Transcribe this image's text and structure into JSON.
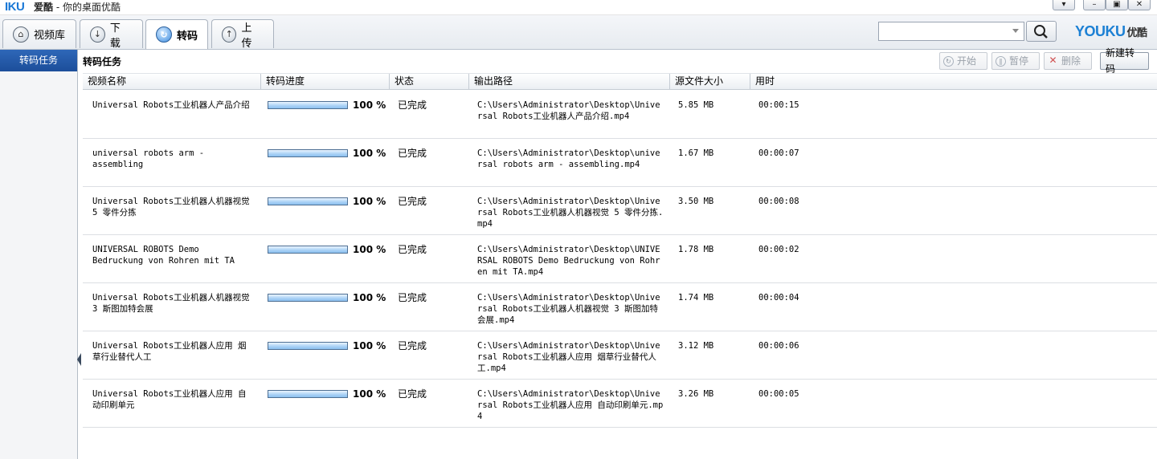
{
  "app": {
    "logo": "IKU",
    "title_bold": "爱酷",
    "title_rest": " - 你的桌面优酷"
  },
  "window_controls": {
    "menu": "▾",
    "minimize": "–",
    "restore": "▣",
    "close": "✕"
  },
  "tabs": [
    {
      "label": "视频库",
      "icon": "house-icon"
    },
    {
      "label": "下 载",
      "icon": "download-icon"
    },
    {
      "label": "转码",
      "icon": "transcode-icon",
      "active": true
    },
    {
      "label": "上 传",
      "icon": "upload-icon"
    }
  ],
  "search": {
    "value": "",
    "placeholder": ""
  },
  "brand": {
    "name": "YOUKU",
    "cn": "优酷"
  },
  "sidebar": {
    "items": [
      {
        "label": "转码任务",
        "active": true
      }
    ]
  },
  "main": {
    "title": "转码任务",
    "toolbar": {
      "start": "开始",
      "pause": "暂停",
      "delete": "删除",
      "new": "新建转码"
    },
    "columns": [
      "视频名称",
      "转码进度",
      "状态",
      "输出路径",
      "源文件大小",
      "用时"
    ],
    "rows": [
      {
        "name": "Universal  Robots工业机器人产品介绍",
        "progress": 100,
        "progress_label": "100 %",
        "status": "已完成",
        "path": "C:\\Users\\Administrator\\Desktop\\Universal  Robots工业机器人产品介绍.mp4",
        "size": "5.85 MB",
        "time": "00:00:15"
      },
      {
        "name": "universal robots arm - assembling",
        "progress": 100,
        "progress_label": "100 %",
        "status": "已完成",
        "path": "C:\\Users\\Administrator\\Desktop\\universal robots arm - assembling.mp4",
        "size": "1.67 MB",
        "time": "00:00:07"
      },
      {
        "name": "Universal  Robots工业机器人机器视觉 5 零件分拣",
        "progress": 100,
        "progress_label": "100 %",
        "status": "已完成",
        "path": "C:\\Users\\Administrator\\Desktop\\Universal  Robots工业机器人机器视觉 5 零件分拣.mp4",
        "size": "3.50 MB",
        "time": "00:00:08"
      },
      {
        "name": "UNIVERSAL ROBOTS Demo Bedruckung von Rohren mit TA",
        "progress": 100,
        "progress_label": "100 %",
        "status": "已完成",
        "path": "C:\\Users\\Administrator\\Desktop\\UNIVERSAL ROBOTS Demo Bedruckung von Rohren mit TA.mp4",
        "size": "1.78 MB",
        "time": "00:00:02"
      },
      {
        "name": "Universal  Robots工业机器人机器视觉 3 斯图加特会展",
        "progress": 100,
        "progress_label": "100 %",
        "status": "已完成",
        "path": "C:\\Users\\Administrator\\Desktop\\Universal  Robots工业机器人机器视觉 3 斯图加特会展.mp4",
        "size": "1.74 MB",
        "time": "00:00:04"
      },
      {
        "name": "Universal  Robots工业机器人应用 烟草行业替代人工",
        "progress": 100,
        "progress_label": "100 %",
        "status": "已完成",
        "path": "C:\\Users\\Administrator\\Desktop\\Universal  Robots工业机器人应用 烟草行业替代人工.mp4",
        "size": "3.12 MB",
        "time": "00:00:06"
      },
      {
        "name": "Universal  Robots工业机器人应用 自动印刷单元",
        "progress": 100,
        "progress_label": "100 %",
        "status": "已完成",
        "path": "C:\\Users\\Administrator\\Desktop\\Universal  Robots工业机器人应用 自动印刷单元.mp4",
        "size": "3.26 MB",
        "time": "00:00:05"
      }
    ]
  }
}
